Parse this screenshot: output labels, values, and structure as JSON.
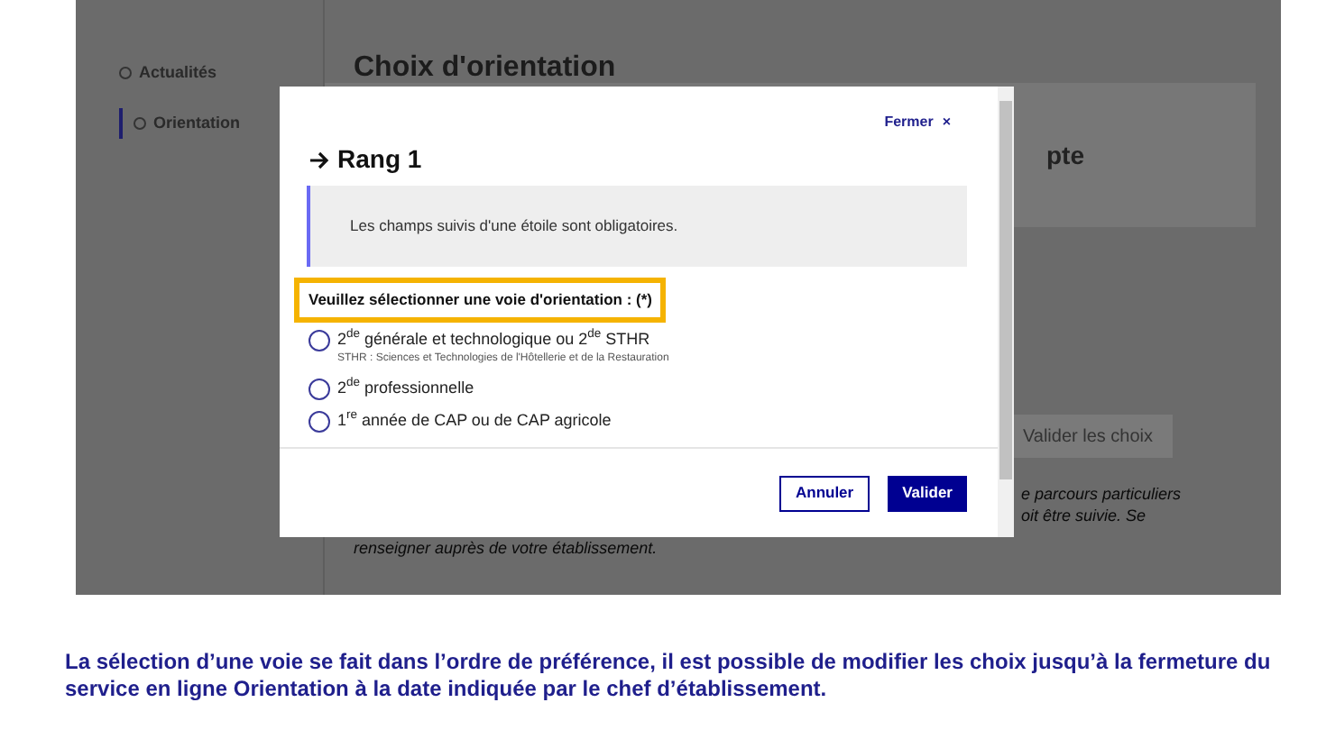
{
  "sidebar": {
    "items": [
      {
        "label": "Actualités",
        "selected": false
      },
      {
        "label": "Orientation",
        "selected": true
      }
    ]
  },
  "page": {
    "title": "Choix d'orientation",
    "panel_text": "pte",
    "validate_button": "Valider les choix",
    "note_lines": [
      "e parcours particuliers",
      "oit être suivie. Se",
      "renseigner auprès de votre établissement."
    ]
  },
  "modal": {
    "close": "Fermer",
    "close_icon": "×",
    "heading": "Rang 1",
    "notice": "Les champs suivis d'une étoile sont obligatoires.",
    "question": "Veuillez sélectionner une voie d'orientation : (*)",
    "options": [
      {
        "label": "2$^{de}$ générale et technologique ou 2$^{de}$ STHR",
        "hint": "STHR : Sciences et Technologies de l'Hôtellerie et de la Restauration",
        "selected": false
      },
      {
        "label": "2$^{de}$ professionnelle",
        "selected": false
      },
      {
        "label": "1$^{re}$ année de CAP ou de CAP agricole",
        "selected": false
      }
    ],
    "buttons": [
      {
        "label": "Annuler",
        "kind": "secondary"
      },
      {
        "label": "Valider",
        "kind": "primary"
      }
    ]
  },
  "caption": "La sélection d’une voie se fait dans l’ordre de préférence, il est possible de modifier les choix jusqu’à la fermeture du service en ligne Orientation à la date indiquée par le chef d’établissement."
}
